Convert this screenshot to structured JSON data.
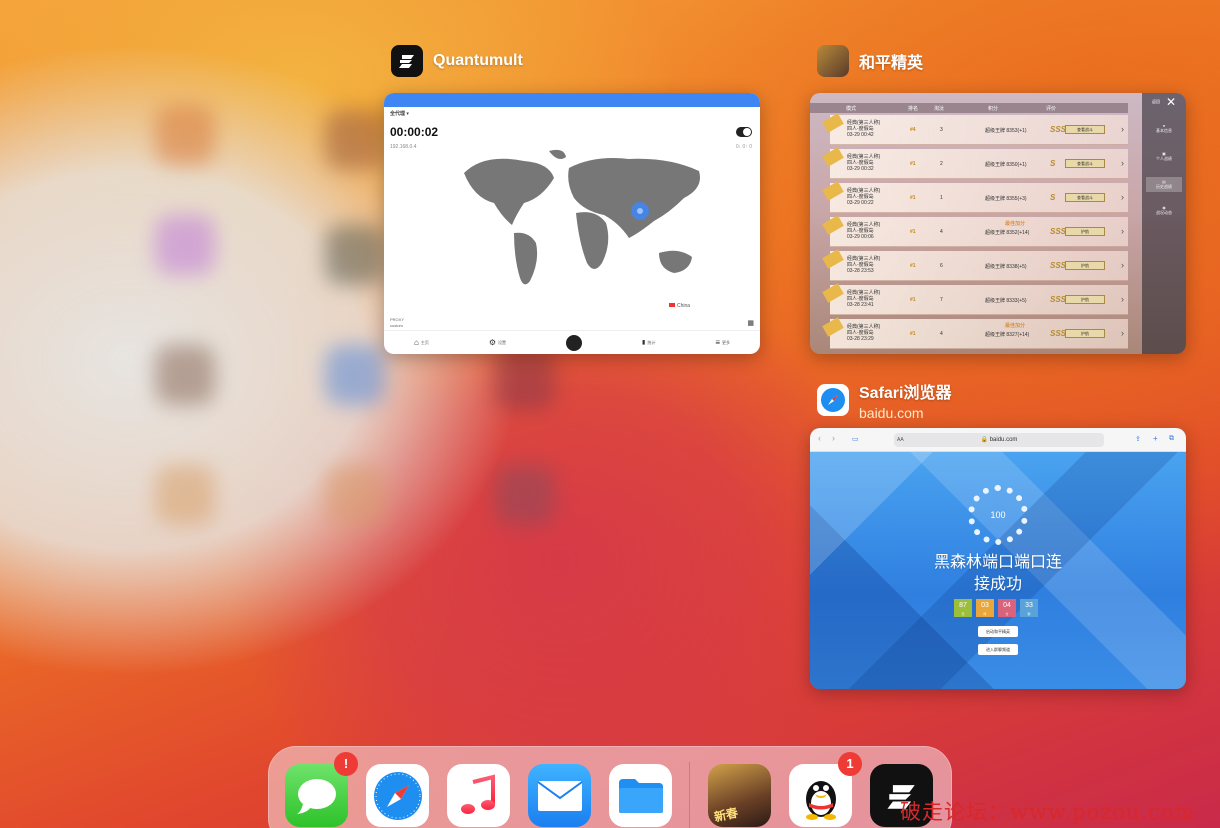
{
  "wallpaper": {
    "accent": "#ef7a24",
    "highlight": "#d63a47"
  },
  "apps": {
    "quantumult": {
      "name": "Quantumult",
      "screen": {
        "title": "全代理 ▾",
        "timer": "00:00:02",
        "ip": "192.168.0.4",
        "stats": "0↓  0↑  0",
        "legend": "China",
        "proxy_label": "PROXY",
        "proxy_value": "custom",
        "tabs": [
          {
            "label": "主页",
            "icon": "home-icon",
            "glyph": "⌂"
          },
          {
            "label": "设置",
            "icon": "gear-icon",
            "glyph": "⚙"
          },
          {
            "label": "统计",
            "icon": "chart-icon",
            "glyph": "▮"
          },
          {
            "label": "更多",
            "icon": "more-icon",
            "glyph": "≡"
          }
        ]
      }
    },
    "game": {
      "name": "和平精英",
      "screen": {
        "headers": [
          "模式",
          "排名",
          "淘汰",
          "积分",
          "评价"
        ],
        "side_label": "返回",
        "side_items": [
          "基本信息",
          "个人战绩",
          "历史战绩",
          "战况动态"
        ],
        "rows": [
          {
            "mode": "经典(第三人称)",
            "map": "四人-度假岛",
            "time": "03-29 00:42",
            "rank": "#4",
            "kills": "3",
            "tier": "超级王牌",
            "score": "8353(+1)",
            "grade": "SSS",
            "action": "查看战斗"
          },
          {
            "mode": "经典(第三人称)",
            "map": "四人-度假岛",
            "time": "03-29 00:32",
            "rank": "#1",
            "kills": "2",
            "tier": "超级王牌",
            "score": "8350(+1)",
            "grade": "S",
            "action": "查看战斗"
          },
          {
            "mode": "经典(第三人称)",
            "map": "四人-度假岛",
            "time": "03-29 00:22",
            "rank": "#1",
            "kills": "1",
            "tier": "超级王牌",
            "score": "8355(+3)",
            "grade": "S",
            "action": "查看战斗"
          },
          {
            "mode": "经典(第三人称)",
            "map": "四人-度假岛",
            "time": "03-29 00:06",
            "rank": "#1",
            "kills": "4",
            "tier": "超级王牌",
            "score": "8352(+14)",
            "grade": "SSS",
            "action": "护航",
            "note": "最佳加分"
          },
          {
            "mode": "经典(第三人称)",
            "map": "四人-度假岛",
            "time": "03-28 23:53",
            "rank": "#1",
            "kills": "6",
            "tier": "超级王牌",
            "score": "8338(+5)",
            "grade": "SSS",
            "action": "护航"
          },
          {
            "mode": "经典(第三人称)",
            "map": "四人-度假岛",
            "time": "03-28 23:41",
            "rank": "#1",
            "kills": "7",
            "tier": "超级王牌",
            "score": "8333(+5)",
            "grade": "SSS",
            "action": "护航"
          },
          {
            "mode": "经典(第三人称)",
            "map": "四人-度假岛",
            "time": "03-28 23:29",
            "rank": "#1",
            "kills": "4",
            "tier": "超级王牌",
            "score": "8327(+14)",
            "grade": "SSS",
            "action": "护航",
            "note": "最佳加分"
          }
        ]
      }
    },
    "safari": {
      "name": "Safari浏览器",
      "subtitle": "baidu.com",
      "screen": {
        "aa": "AA",
        "url": "🔒 baidu.com",
        "ring": "100",
        "headline": "黑森林端口端口连",
        "headline2": "接成功",
        "counts": [
          {
            "value": "87",
            "unit": "天",
            "color": "#9bbf3a"
          },
          {
            "value": "03",
            "unit": "时",
            "color": "#e9a63a"
          },
          {
            "value": "04",
            "unit": "分",
            "color": "#d9637a"
          },
          {
            "value": "33",
            "unit": "秒",
            "color": "#5aa3d8"
          }
        ],
        "buttons": [
          "启动和平精英",
          "进入群聊频道"
        ]
      }
    }
  },
  "dock": {
    "items": [
      {
        "name": "messages",
        "badge": "!"
      },
      {
        "name": "safari"
      },
      {
        "name": "music"
      },
      {
        "name": "mail"
      },
      {
        "name": "files"
      },
      {
        "name": "peace-elite",
        "label": "新春"
      },
      {
        "name": "qq",
        "badge": "1"
      },
      {
        "name": "quantumult"
      }
    ]
  },
  "watermark": "破走论坛：www.pozou.com"
}
